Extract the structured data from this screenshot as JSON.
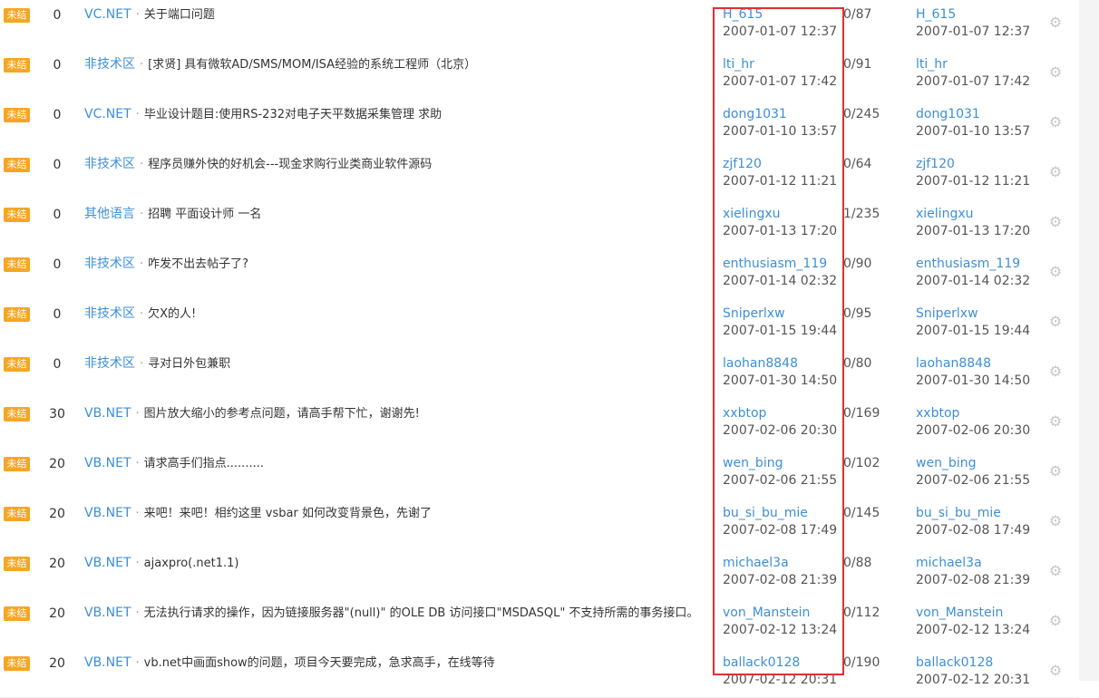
{
  "threads": [
    {
      "status": "未结",
      "score": "0",
      "forum": "VC.NET",
      "title": "关于端口问题",
      "author": "H_615",
      "author_time": "2007-01-07 12:37",
      "replies": "0/87",
      "last_user": "H_615",
      "last_time": "2007-01-07 12:37"
    },
    {
      "status": "未结",
      "score": "0",
      "forum": "非技术区",
      "title": "[求贤] 具有微软AD/SMS/MOM/ISA经验的系统工程师（北京）",
      "author": "lti_hr",
      "author_time": "2007-01-07 17:42",
      "replies": "0/91",
      "last_user": "lti_hr",
      "last_time": "2007-01-07 17:42"
    },
    {
      "status": "未结",
      "score": "0",
      "forum": "VC.NET",
      "title": "毕业设计题目:使用RS-232对电子天平数据采集管理 求助",
      "author": "dong1031",
      "author_time": "2007-01-10 13:57",
      "replies": "0/245",
      "last_user": "dong1031",
      "last_time": "2007-01-10 13:57"
    },
    {
      "status": "未结",
      "score": "0",
      "forum": "非技术区",
      "title": "程序员赚外快的好机会---现金求购行业类商业软件源码",
      "author": "zjf120",
      "author_time": "2007-01-12 11:21",
      "replies": "0/64",
      "last_user": "zjf120",
      "last_time": "2007-01-12 11:21"
    },
    {
      "status": "未结",
      "score": "0",
      "forum": "其他语言",
      "title": "招聘 平面设计师 一名",
      "author": "xielingxu",
      "author_time": "2007-01-13 17:20",
      "replies": "1/235",
      "last_user": "xielingxu",
      "last_time": "2007-01-13 17:20"
    },
    {
      "status": "未结",
      "score": "0",
      "forum": "非技术区",
      "title": "咋发不出去帖子了?",
      "author": "enthusiasm_119",
      "author_time": "2007-01-14 02:32",
      "replies": "0/90",
      "last_user": "enthusiasm_119",
      "last_time": "2007-01-14 02:32"
    },
    {
      "status": "未结",
      "score": "0",
      "forum": "非技术区",
      "title": "欠X的人!",
      "author": "Sniperlxw",
      "author_time": "2007-01-15 19:44",
      "replies": "0/95",
      "last_user": "Sniperlxw",
      "last_time": "2007-01-15 19:44"
    },
    {
      "status": "未结",
      "score": "0",
      "forum": "非技术区",
      "title": "寻对日外包兼职",
      "author": "laohan8848",
      "author_time": "2007-01-30 14:50",
      "replies": "0/80",
      "last_user": "laohan8848",
      "last_time": "2007-01-30 14:50"
    },
    {
      "status": "未结",
      "score": "30",
      "forum": "VB.NET",
      "title": "图片放大缩小的参考点问题，请高手帮下忙，谢谢先!",
      "author": "xxbtop",
      "author_time": "2007-02-06 20:30",
      "replies": "0/169",
      "last_user": "xxbtop",
      "last_time": "2007-02-06 20:30"
    },
    {
      "status": "未结",
      "score": "20",
      "forum": "VB.NET",
      "title": "请求高手们指点..........",
      "author": "wen_bing",
      "author_time": "2007-02-06 21:55",
      "replies": "0/102",
      "last_user": "wen_bing",
      "last_time": "2007-02-06 21:55"
    },
    {
      "status": "未结",
      "score": "20",
      "forum": "VB.NET",
      "title": "来吧！来吧！相约这里 vsbar 如何改变背景色，先谢了",
      "author": "bu_si_bu_mie",
      "author_time": "2007-02-08 17:49",
      "replies": "0/145",
      "last_user": "bu_si_bu_mie",
      "last_time": "2007-02-08 17:49"
    },
    {
      "status": "未结",
      "score": "20",
      "forum": "VB.NET",
      "title": "ajaxpro(.net1.1)",
      "author": "michael3a",
      "author_time": "2007-02-08 21:39",
      "replies": "0/88",
      "last_user": "michael3a",
      "last_time": "2007-02-08 21:39"
    },
    {
      "status": "未结",
      "score": "20",
      "forum": "VB.NET",
      "title": "无法执行请求的操作，因为链接服务器\"(null)\" 的OLE DB 访问接口\"MSDASQL\" 不支持所需的事务接口。",
      "author": "von_Manstein",
      "author_time": "2007-02-12 13:24",
      "replies": "0/112",
      "last_user": "von_Manstein",
      "last_time": "2007-02-12 13:24"
    },
    {
      "status": "未结",
      "score": "20",
      "forum": "VB.NET",
      "title": "vb.net中画面show的问题，项目今天要完成，急求高手，在线等待",
      "author": "ballack0128",
      "author_time": "2007-02-12 20:31",
      "replies": "0/190",
      "last_user": "ballack0128",
      "last_time": "2007-02-12 20:31"
    }
  ],
  "separator": "·",
  "colors": {
    "forum_link": "#3d8fd8",
    "status_badge": "#f5a623",
    "highlight": "#e03030"
  },
  "icons": {
    "row_action": "gear-icon"
  }
}
